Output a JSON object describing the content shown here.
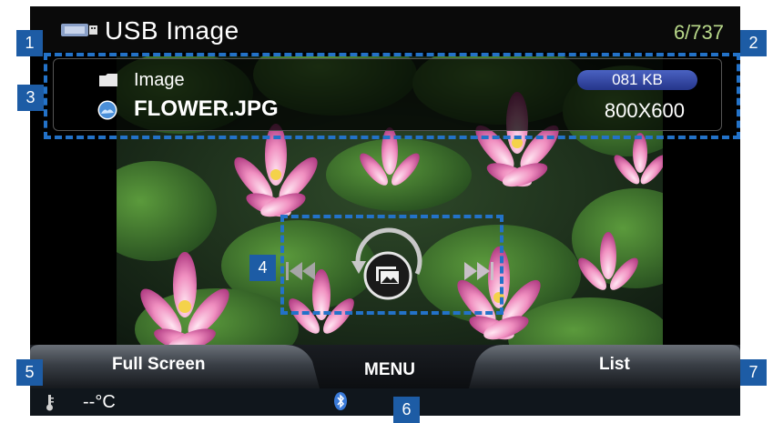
{
  "header": {
    "title": "USB Image",
    "counter": "6/737",
    "usb_icon": "usb-icon"
  },
  "file_info": {
    "folder_label": "Image",
    "file_name": "FLOWER.JPG",
    "file_size": "081 KB",
    "resolution": "800X600"
  },
  "controls": {
    "previous_icon": "skip-previous-icon",
    "slideshow_icon": "slideshow-icon",
    "next_icon": "skip-next-icon"
  },
  "menu": {
    "full_screen_label": "Full Screen",
    "menu_label": "MENU",
    "list_label": "List"
  },
  "status": {
    "temperature": "--°C",
    "bluetooth_icon": "bluetooth-icon"
  },
  "callouts": [
    "1",
    "2",
    "3",
    "4",
    "5",
    "6",
    "7"
  ],
  "colors": {
    "counter": "#b9d98a",
    "badge": "#3a50b0",
    "callout": "#1d5ca5",
    "dash": "#2372c8"
  }
}
